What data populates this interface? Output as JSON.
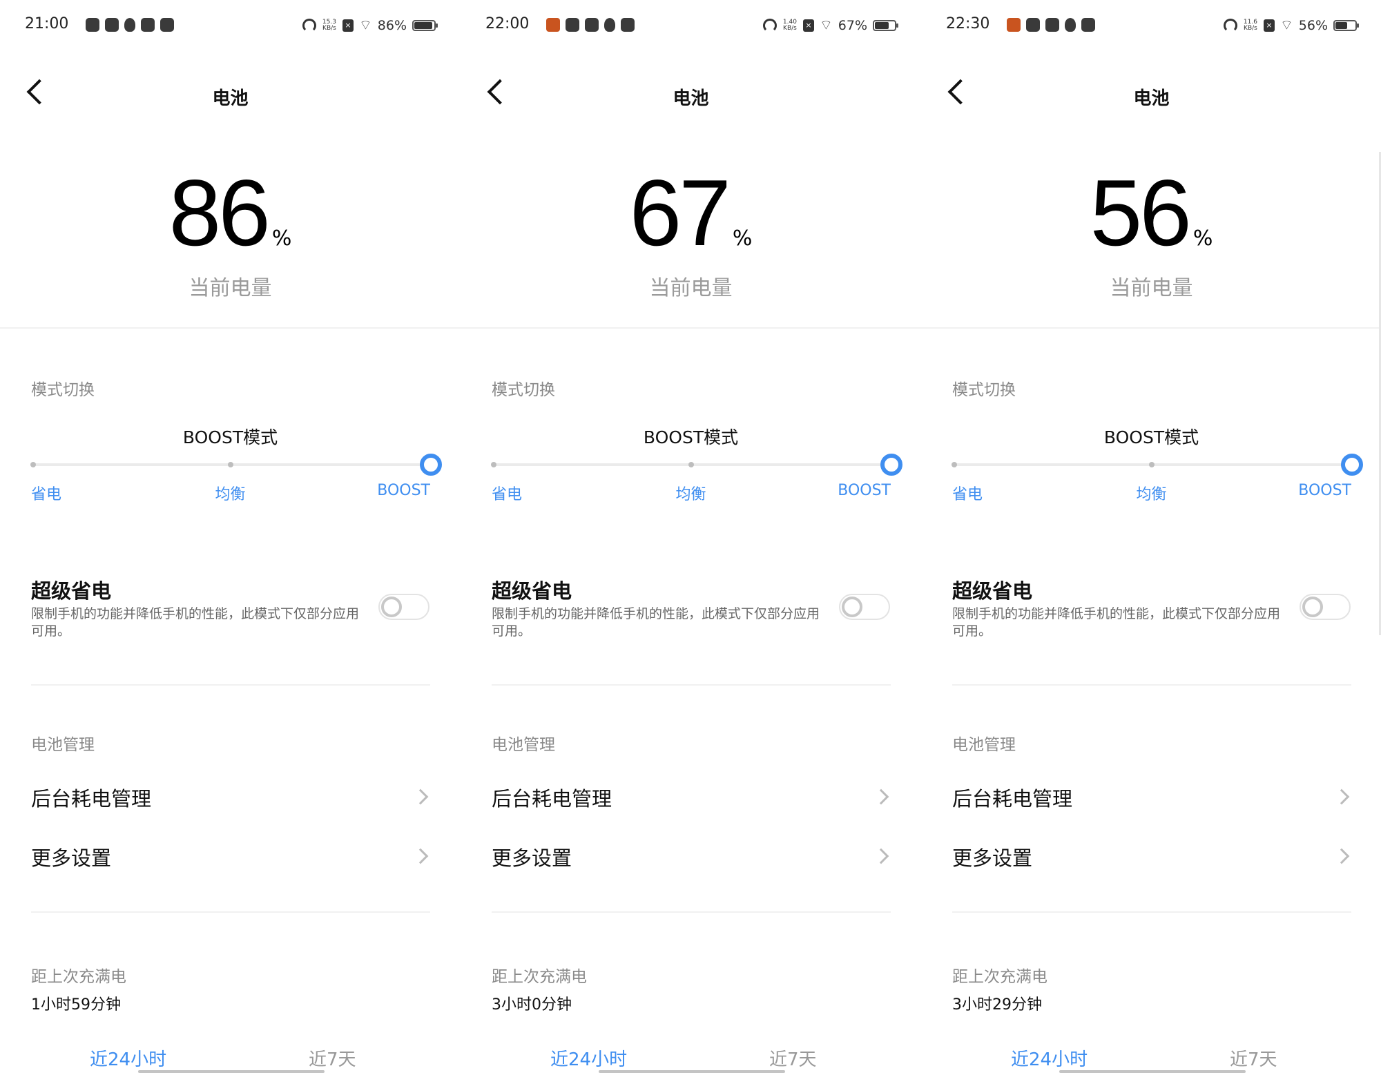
{
  "panels": [
    {
      "status": {
        "time": "21:00",
        "speed": "15.3",
        "speed_unit": "KB/s",
        "battery_pct": "86%",
        "battery_level": 0.86
      },
      "header": {
        "title": "电池"
      },
      "battery": {
        "value": "86",
        "unit": "%",
        "label": "当前电量"
      },
      "mode": {
        "section": "模式切换",
        "current": "BOOST模式",
        "options": [
          "省电",
          "均衡",
          "BOOST"
        ],
        "selected": "BOOST"
      },
      "super_saver": {
        "title": "超级省电",
        "desc": "限制手机的功能并降低手机的性能，此模式下仅部分应用可用。",
        "enabled": false
      },
      "manage": {
        "section": "电池管理",
        "items": [
          "后台耗电管理",
          "更多设置"
        ]
      },
      "since": {
        "label": "距上次充满电",
        "value": "1小时59分钟"
      },
      "tabs": [
        "近24小时",
        "近7天"
      ]
    },
    {
      "status": {
        "time": "22:00",
        "speed": "1.40",
        "speed_unit": "KB/s",
        "battery_pct": "67%",
        "battery_level": 0.67
      },
      "header": {
        "title": "电池"
      },
      "battery": {
        "value": "67",
        "unit": "%",
        "label": "当前电量"
      },
      "mode": {
        "section": "模式切换",
        "current": "BOOST模式",
        "options": [
          "省电",
          "均衡",
          "BOOST"
        ],
        "selected": "BOOST"
      },
      "super_saver": {
        "title": "超级省电",
        "desc": "限制手机的功能并降低手机的性能，此模式下仅部分应用可用。",
        "enabled": false
      },
      "manage": {
        "section": "电池管理",
        "items": [
          "后台耗电管理",
          "更多设置"
        ]
      },
      "since": {
        "label": "距上次充满电",
        "value": "3小时0分钟"
      },
      "tabs": [
        "近24小时",
        "近7天"
      ]
    },
    {
      "status": {
        "time": "22:30",
        "speed": "11.6",
        "speed_unit": "KB/s",
        "battery_pct": "56%",
        "battery_level": 0.56
      },
      "header": {
        "title": "电池"
      },
      "battery": {
        "value": "56",
        "unit": "%",
        "label": "当前电量"
      },
      "mode": {
        "section": "模式切换",
        "current": "BOOST模式",
        "options": [
          "省电",
          "均衡",
          "BOOST"
        ],
        "selected": "BOOST"
      },
      "super_saver": {
        "title": "超级省电",
        "desc": "限制手机的功能并降低手机的性能，此模式下仅部分应用可用。",
        "enabled": false
      },
      "manage": {
        "section": "电池管理",
        "items": [
          "后台耗电管理",
          "更多设置"
        ]
      },
      "since": {
        "label": "距上次充满电",
        "value": "3小时29分钟"
      },
      "tabs": [
        "近24小时",
        "近7天"
      ]
    }
  ],
  "colors": {
    "accent": "#3f8ef0",
    "muted": "#8a8a8a",
    "toggle_off": "#c8c8c8"
  }
}
